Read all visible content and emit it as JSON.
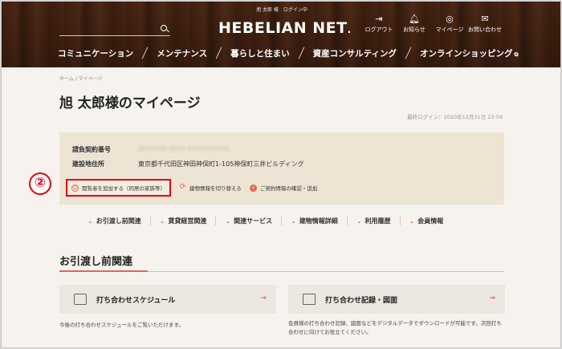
{
  "header": {
    "greeting": "旭 太郎 様　ログイン中",
    "logo": "HEBELIAN NET",
    "logo_dot": ".",
    "tools": [
      {
        "icon": "logout-icon",
        "glyph": "⇥",
        "label": "ログアウト"
      },
      {
        "icon": "bell-icon",
        "glyph": "🔔︎",
        "label": "お知らせ"
      },
      {
        "icon": "user-icon",
        "glyph": "◎",
        "label": "マイページ"
      },
      {
        "icon": "mail-icon",
        "glyph": "✉",
        "label": "お問い合わせ"
      }
    ],
    "nav": [
      "コミュニケーション",
      "メンテナンス",
      "暮らしと住まい",
      "資産コンサルティング",
      "オンラインショッピング"
    ],
    "nav_ext_glyph": "⧉"
  },
  "breadcrumb": "ホーム / マイページ",
  "page_title": "旭 太郎様のマイページ",
  "last_login": "最終ログイン：2020年12月31日 23:59",
  "contract": {
    "number_label": "請負契約番号",
    "number_value": "0000000-0000-0000000000",
    "address_label": "建設地住所",
    "address_value": "東京都千代田区神田神保町1-105神保町三井ビルディング"
  },
  "actions": [
    {
      "label": "閲覧者を追加する（同居の家族等）",
      "glyph": "☺"
    },
    {
      "label": "建物情報を切り替える",
      "glyph": "⟳"
    },
    {
      "label": "ご契約情報の確認・追加",
      "glyph": "+"
    }
  ],
  "step_marker": "②",
  "subnav": [
    "お引渡し前関連",
    "賃貸経営関連",
    "関連サービス",
    "建物情報詳細",
    "利用履歴",
    "会員情報"
  ],
  "subnav_glyph": "⌄",
  "section_title": "お引渡し前関連",
  "cards": [
    {
      "title": "打ち合わせスケジュール",
      "desc": "今後の打ち合わせスケジュールをご覧いただけます。"
    },
    {
      "title": "打ち合わせ記録・図面",
      "desc": "会員様の打ち合わせ記録、図面などをデジタルデータでダウンロードが可能です。次回打ち合わせに向けてお役立てください。"
    }
  ],
  "card_arrow": "→",
  "colors": {
    "accent": "#e0694c",
    "highlight": "#e60012"
  }
}
